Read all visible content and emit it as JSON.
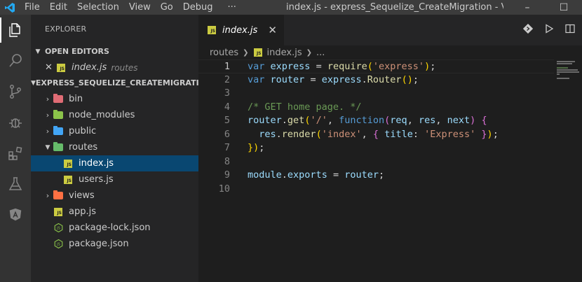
{
  "titlebar": {
    "menu": [
      "File",
      "Edit",
      "Selection",
      "View",
      "Go",
      "Debug",
      "···"
    ],
    "title": "index.js - express_Sequelize_CreateMigration - Visual S...",
    "controls": [
      "–",
      "☐"
    ]
  },
  "activity_bar": [
    "explorer-icon",
    "search-icon",
    "source-control-icon",
    "debug-icon",
    "extensions-icon",
    "testing-icon",
    "angular-icon"
  ],
  "sidebar": {
    "title": "EXPLORER",
    "open_editors": {
      "header": "OPEN EDITORS",
      "items": [
        {
          "name": "index.js",
          "folder": "routes"
        }
      ]
    },
    "project": {
      "header": "EXPRESS_SEQUELIZE_CREATEMIGRATI...",
      "items": [
        {
          "name": "bin",
          "kind": "folder",
          "color": "#e06c75"
        },
        {
          "name": "node_modules",
          "kind": "folder",
          "color": "#8bc34a"
        },
        {
          "name": "public",
          "kind": "folder",
          "color": "#42a5f5"
        },
        {
          "name": "routes",
          "kind": "folder-open",
          "color": "#66bb6a"
        },
        {
          "name": "index.js",
          "kind": "js"
        },
        {
          "name": "users.js",
          "kind": "js"
        },
        {
          "name": "views",
          "kind": "folder",
          "color": "#ff7043"
        },
        {
          "name": "app.js",
          "kind": "js"
        },
        {
          "name": "package-lock.json",
          "kind": "npm"
        },
        {
          "name": "package.json",
          "kind": "npm"
        }
      ]
    }
  },
  "tab": {
    "name": "index.js",
    "badge": "JS"
  },
  "breadcrumb": {
    "folder": "routes",
    "file": "index.js",
    "more": "..."
  },
  "code_lines": [
    "var express = require('express');",
    "var router = express.Router();",
    "",
    "/* GET home page. */",
    "router.get('/', function(req, res, next) {",
    "  res.render('index', { title: 'Express' });",
    "});",
    "",
    "module.exports = router;",
    ""
  ],
  "line_numbers": [
    "1",
    "2",
    "3",
    "4",
    "5",
    "6",
    "7",
    "8",
    "9",
    "10"
  ]
}
